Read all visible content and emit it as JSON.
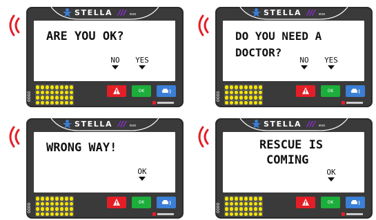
{
  "brand": {
    "name": "STELLA",
    "stripes": "///",
    "suffix": "evo"
  },
  "serial": "0000",
  "colors": {
    "signal": "#e41e26",
    "warn_button": "#e41e26",
    "ok_button": "#1cae3a",
    "car_button": "#3b7fd6",
    "led": "#f4e500",
    "brand_accent": "#9c2df0"
  },
  "buttons": {
    "warn_icon": "warning-triangle-icon",
    "ok_label": "OK",
    "car_icon": "car-signal-icon"
  },
  "panels": [
    {
      "message_lines": [
        "ARE YOU OK?"
      ],
      "options": [
        "NO",
        "YES"
      ]
    },
    {
      "message_lines": [
        "DO YOU NEED A",
        "DOCTOR?"
      ],
      "options": [
        "NO",
        "YES"
      ]
    },
    {
      "message_lines": [
        "WRONG WAY!"
      ],
      "options": [
        "OK"
      ]
    },
    {
      "message_lines": [
        "RESCUE IS",
        "COMING"
      ],
      "options": [
        "OK"
      ]
    }
  ]
}
